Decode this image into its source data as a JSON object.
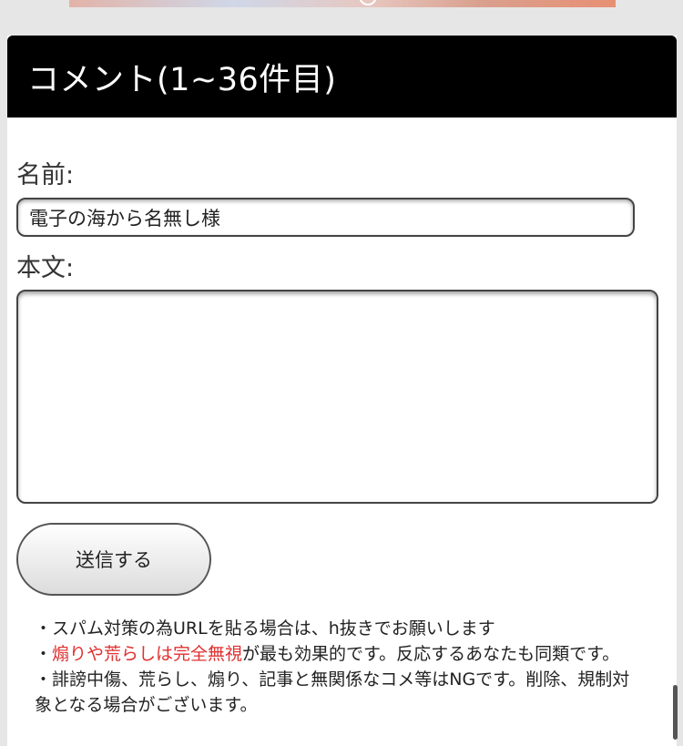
{
  "header": {
    "title": "コメント(1~36件目)"
  },
  "form": {
    "name_label": "名前:",
    "name_value": "電子の海から名無し様",
    "body_label": "本文:",
    "body_value": "",
    "submit_label": "送信する"
  },
  "notes": {
    "line1": "・スパム対策の為URLを貼る場合は、h抜きでお願いします",
    "line2_prefix": "・",
    "line2_red": "煽りや荒らしは完全無視",
    "line2_rest": "が最も効果的です。反応するあなたも同類です。",
    "line3": "・誹謗中傷、荒らし、煽り、記事と無関係なコメ等はNGです。削除、規制対象となる場合がございます。"
  },
  "colors": {
    "header_bg": "#000000",
    "warning_red": "#e03030"
  }
}
